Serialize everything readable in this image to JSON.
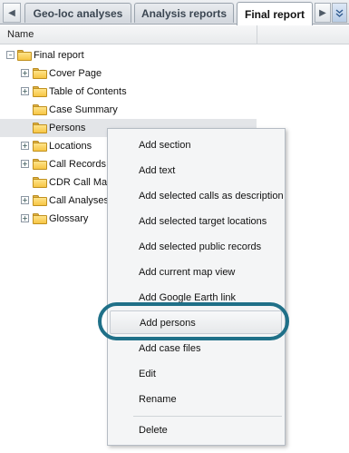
{
  "tabs": [
    {
      "label": "Geo-loc analyses"
    },
    {
      "label": "Analysis reports"
    },
    {
      "label": "Final report",
      "active": true
    }
  ],
  "icons": {
    "scroll_left": "triangle-left-icon",
    "scroll_right": "triangle-right-icon",
    "overflow": "double-chevron-down-icon",
    "folder": "folder-icon",
    "expand": "plus-expander-icon",
    "collapse": "minus-expander-icon"
  },
  "header": {
    "name_label": "Name"
  },
  "tree": {
    "root": {
      "label": "Final report",
      "expanded": true
    },
    "items": [
      {
        "label": "Cover Page",
        "expandable": true
      },
      {
        "label": "Table of Contents",
        "expandable": true
      },
      {
        "label": "Case Summary",
        "expandable": false
      },
      {
        "label": "Persons",
        "expandable": false,
        "selected": true
      },
      {
        "label": "Locations",
        "expandable": true
      },
      {
        "label": "Call Records",
        "expandable": true
      },
      {
        "label": "CDR Call Map",
        "expandable": false
      },
      {
        "label": "Call Analyses",
        "expandable": true
      },
      {
        "label": "Glossary",
        "expandable": true
      }
    ]
  },
  "context_menu": {
    "items": [
      {
        "label": "Add section"
      },
      {
        "label": "Add text"
      },
      {
        "label": "Add selected calls as description"
      },
      {
        "label": "Add selected target locations"
      },
      {
        "label": "Add selected public records"
      },
      {
        "label": "Add current map view"
      },
      {
        "label": "Add Google Earth link"
      },
      {
        "label": "Add persons",
        "hovered": true
      },
      {
        "label": "Add case files"
      },
      {
        "label": "Edit"
      },
      {
        "label": "Rename"
      },
      {
        "label": "Delete"
      }
    ],
    "highlight_color": "#1f7088"
  }
}
